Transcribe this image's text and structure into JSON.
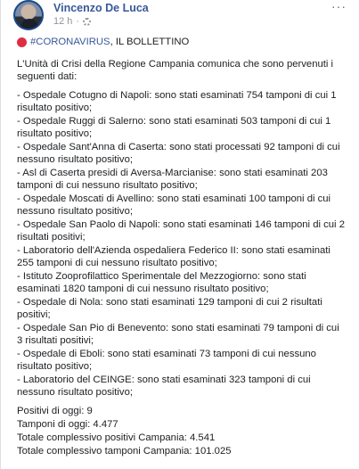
{
  "post": {
    "author": "Vincenzo De Luca",
    "time": "12 h",
    "meta_separator": "·",
    "more_icon": "···",
    "hashtag": "#CORONAVIRUS",
    "title_rest": ", IL BOLLETTINO",
    "intro": "L'Unità di Crisi della Regione Campania comunica che sono pervenuti i seguenti dati:",
    "items": [
      "- Ospedale Cotugno di Napoli: sono stati esaminati 754 tamponi di cui 1 risultato positivo;",
      "- Ospedale Ruggi di Salerno: sono stati esaminati 503 tamponi di cui 1 risultato positivo;",
      "- Ospedale Sant'Anna di Caserta: sono stati processati 92 tamponi di cui nessuno risultato positivo;",
      "- Asl di Caserta presidi di Aversa-Marcianise: sono stati esaminati 203 tamponi di cui nessuno risultato positivo;",
      "- Ospedale Moscati di Avellino: sono stati esaminati 100 tamponi di cui nessuno risultato positivo;",
      "- Ospedale San Paolo di Napoli: sono stati esaminati 146 tamponi di cui 2 risultati positivi;",
      "- Laboratorio dell'Azienda ospedaliera Federico II: sono stati esaminati 255 tamponi di cui nessuno risultato positivo;",
      "- Istituto Zooprofilattico Sperimentale del Mezzogiorno: sono stati esaminati 1820 tamponi di cui nessuno risultato positivo;",
      "- Ospedale di Nola: sono stati esaminati 129 tamponi di cui 2 risultati positivi;",
      "- Ospedale San Pio di Benevento: sono stati esaminati 79 tamponi di cui 3 risultati positivi;",
      "- Ospedale di Eboli: sono stati esaminati 73 tamponi di cui nessuno risultato positivo;",
      "- Laboratorio del CEINGE: sono stati esaminati 323 tamponi di cui nessuno risultato positivo;"
    ],
    "stats": [
      "Positivi di oggi: 9",
      "Tamponi di oggi: 4.477",
      "Totale complessivo positivi Campania: 4.541",
      "Totale complessivo tamponi Campania: 101.025"
    ]
  },
  "icons": {
    "avatar": "avatar",
    "privacy": "gear-icon",
    "more": "more-icon",
    "red_circle": "red-circle-icon"
  },
  "colors": {
    "link": "#385898",
    "meta": "#90949c",
    "red_circle": "#dd2e44"
  }
}
